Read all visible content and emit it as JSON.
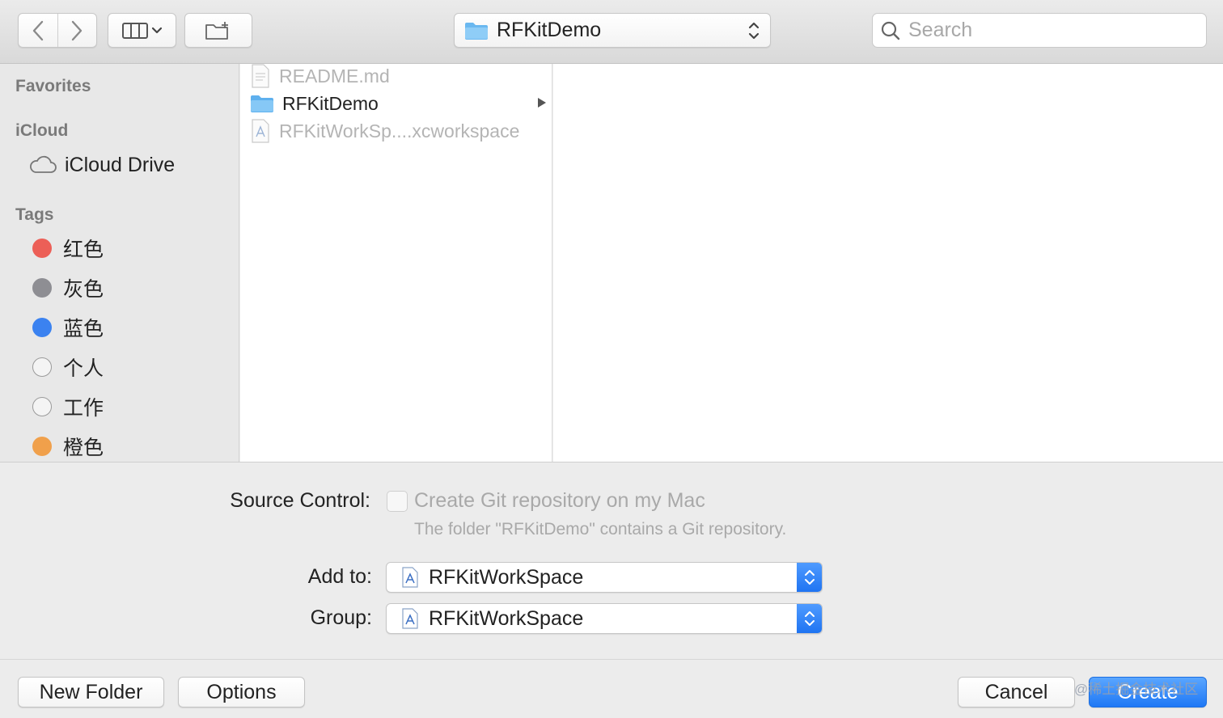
{
  "toolbar": {
    "back_icon": "chevron-left-icon",
    "forward_icon": "chevron-right-icon",
    "view_icon": "columns-view-icon",
    "new_folder_icon": "new-folder-icon",
    "location": "RFKitDemo",
    "search_placeholder": "Search"
  },
  "sidebar": {
    "favorites_header": "Favorites",
    "icloud_header": "iCloud",
    "icloud_drive": "iCloud Drive",
    "tags_header": "Tags",
    "tags": [
      {
        "label": "红色",
        "color": "#ec5f57"
      },
      {
        "label": "灰色",
        "color": "#8e8e93"
      },
      {
        "label": "蓝色",
        "color": "#3b82f0"
      },
      {
        "label": "个人",
        "color": ""
      },
      {
        "label": "工作",
        "color": ""
      },
      {
        "label": "橙色",
        "color": "#f0a04b"
      }
    ]
  },
  "files": [
    {
      "name": "README.md",
      "type": "document",
      "enabled": false
    },
    {
      "name": "RFKitDemo",
      "type": "folder",
      "enabled": true
    },
    {
      "name": "RFKitWorkSp....xcworkspace",
      "type": "workspace",
      "enabled": false
    }
  ],
  "options": {
    "source_control_label": "Source Control:",
    "git_checkbox_label": "Create Git repository on my Mac",
    "git_note": "The folder \"RFKitDemo\" contains a Git repository.",
    "add_to_label": "Add to:",
    "add_to_value": "RFKitWorkSpace",
    "group_label": "Group:",
    "group_value": "RFKitWorkSpace"
  },
  "buttons": {
    "new_folder": "New Folder",
    "options": "Options",
    "cancel": "Cancel",
    "create": "Create"
  },
  "watermark": "@稀土掘金技术社区"
}
